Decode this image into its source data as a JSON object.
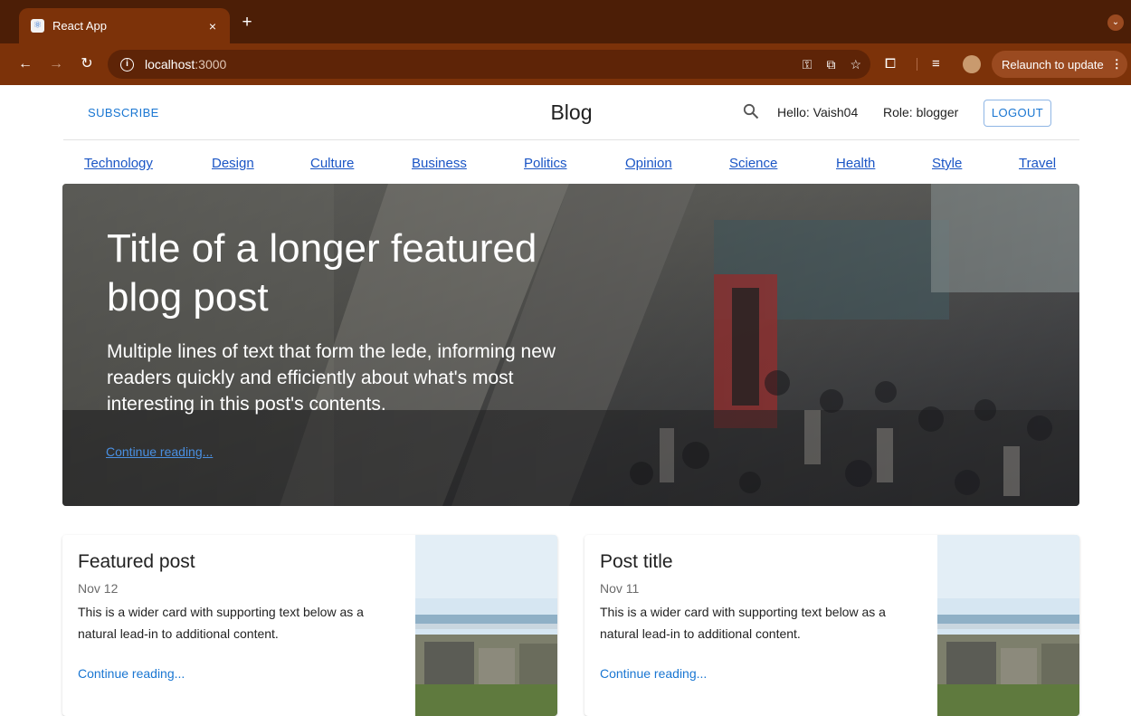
{
  "browser": {
    "tab_title": "React App",
    "tab_close": "×",
    "new_tab": "+",
    "url_host": "localhost",
    "url_port": ":3000",
    "relaunch_label": "Relaunch to update",
    "accent": "#7c3209"
  },
  "header": {
    "subscribe_label": "SUBSCRIBE",
    "title": "Blog",
    "hello": "Hello: Vaish04",
    "role": "Role: blogger",
    "logout_label": "LOGOUT"
  },
  "categories": [
    "Technology",
    "Design",
    "Culture",
    "Business",
    "Politics",
    "Opinion",
    "Science",
    "Health",
    "Style",
    "Travel"
  ],
  "hero": {
    "title": "Title of a longer featured blog post",
    "lede": "Multiple lines of text that form the lede, informing new readers quickly and efficiently about what's most interesting in this post's contents.",
    "link": "Continue reading..."
  },
  "posts": [
    {
      "title": "Featured post",
      "date": "Nov 12",
      "text": "This is a wider card with supporting text below as a natural lead-in to additional content.",
      "link": "Continue reading..."
    },
    {
      "title": "Post title",
      "date": "Nov 11",
      "text": "This is a wider card with supporting text below as a natural lead-in to additional content.",
      "link": "Continue reading..."
    }
  ],
  "colors": {
    "link_blue": "#1976d2",
    "nav_link": "#1a55c5"
  }
}
